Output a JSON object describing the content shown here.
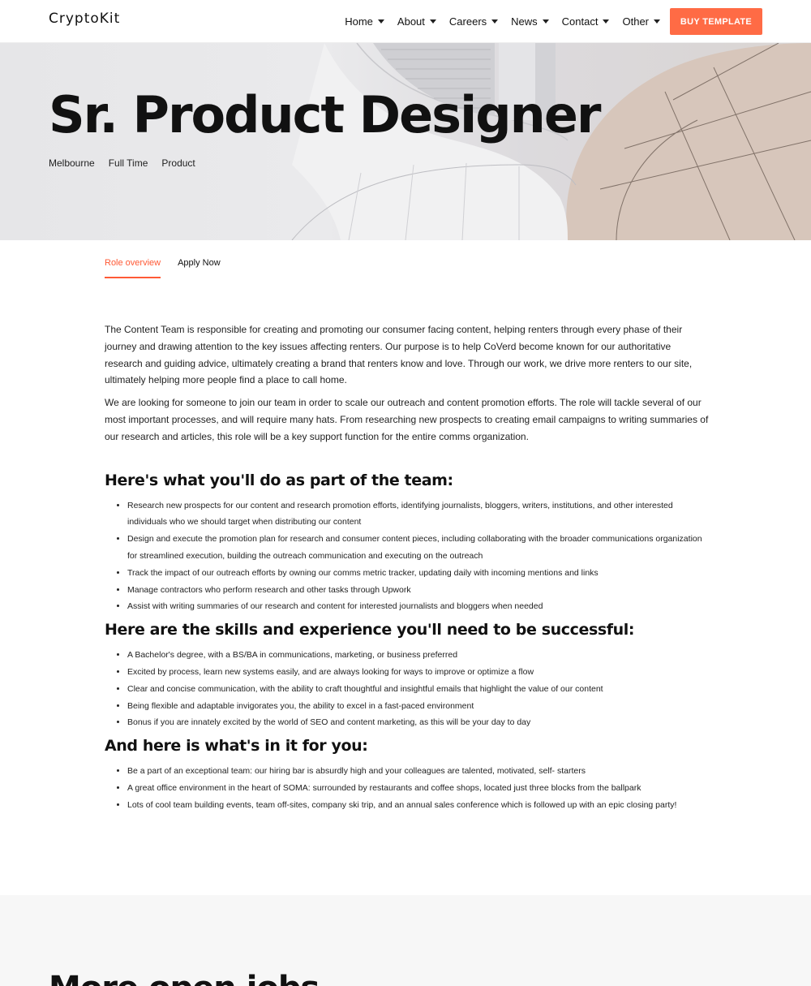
{
  "header": {
    "logo": "CryptoKit",
    "nav": [
      {
        "label": "Home"
      },
      {
        "label": "About"
      },
      {
        "label": "Careers"
      },
      {
        "label": "News"
      },
      {
        "label": "Contact"
      },
      {
        "label": "Other"
      }
    ],
    "cta": "BUY TEMPLATE"
  },
  "hero": {
    "title": "Sr. Product Designer",
    "meta": [
      "Melbourne",
      "Full Time",
      "Product"
    ]
  },
  "tabs": [
    {
      "label": "Role overview",
      "active": true
    },
    {
      "label": "Apply Now",
      "active": false
    }
  ],
  "content": {
    "intro": [
      "The Content Team is responsible for creating and promoting our consumer facing content, helping renters through every phase of their journey and drawing attention to the key issues affecting renters. Our purpose is to help CoVerd become known for our authoritative research and guiding advice, ultimately creating a brand that renters know and love. Through our work, we drive more renters to our site, ultimately helping more people find a place to call home.",
      "We are looking for someone to join our team in order to scale our outreach and content promotion efforts. The role will tackle several of our most important processes, and will require many hats. From researching new prospects to creating email campaigns to writing summaries of our research and articles, this role will be a key support function for the entire comms organization."
    ],
    "sections": [
      {
        "heading": "Here's what you'll do as part of the team:",
        "items": [
          "Research new prospects for our content and research promotion efforts, identifying journalists, bloggers, writers, institutions, and other interested individuals who we should target when distributing our content",
          "Design and execute the promotion plan for research and consumer content pieces, including collaborating with the broader communications organization for streamlined execution, building the outreach communication and executing on the outreach",
          "Track the impact of our outreach efforts by owning our comms metric tracker, updating daily with incoming mentions and links",
          "Manage contractors who perform research and other tasks through Upwork",
          "Assist with writing summaries of our research and content for interested journalists and bloggers when needed"
        ]
      },
      {
        "heading": "Here are the skills and experience you'll need to be successful:",
        "items": [
          "A Bachelor's degree, with a BS/BA in communications, marketing, or business preferred",
          "Excited by process, learn new systems easily, and are always looking for ways to improve or optimize a flow",
          "Clear and concise communication, with the ability to craft thoughtful and insightful emails that highlight the value of our content",
          "Being flexible and adaptable invigorates you, the ability to excel in a fast-paced environment",
          "Bonus if you are innately excited by the world of SEO and content marketing, as this will be your day to day"
        ]
      },
      {
        "heading": "And here is what's in it for you:",
        "items": [
          "Be a part of an exceptional team: our hiring bar is absurdly high and your colleagues are talented, motivated, self- starters",
          "A great office environment in the heart of SOMA: surrounded by restaurants and coffee shops, located just three blocks from the ballpark",
          "Lots of cool team building events, team off-sites, company ski trip, and an annual sales conference which is followed up with an epic closing party!"
        ]
      }
    ]
  },
  "more": {
    "title": "More open jobs"
  },
  "colors": {
    "accent": "#ff5a36",
    "button": "#ff6b45"
  },
  "icons": {
    "nav_caret": "caret-down-icon"
  }
}
